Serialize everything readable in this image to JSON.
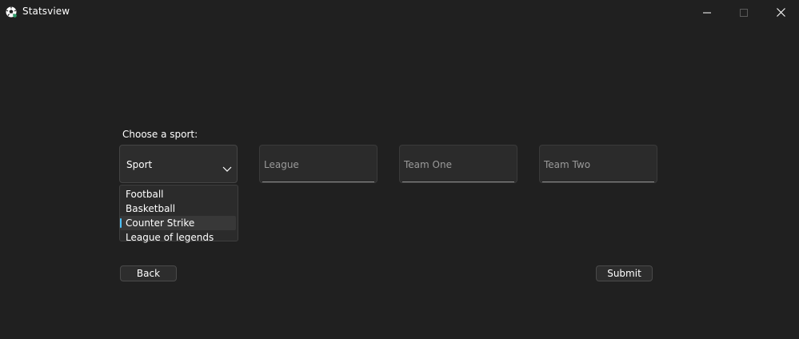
{
  "window": {
    "title": "Statsview",
    "icon": "soccer-ball-icon",
    "controls": [
      "minimize-icon",
      "maximize-icon",
      "close-icon"
    ]
  },
  "form": {
    "sport_label": "Choose a sport:",
    "sport_select": {
      "value": "Sport",
      "options": [
        "Football",
        "Basketball",
        "Counter Strike",
        "League of legends"
      ],
      "highlighted": "Counter Strike"
    },
    "league_placeholder": "League",
    "team_one_placeholder": "Team One",
    "team_two_placeholder": "Team Two"
  },
  "buttons": {
    "back": "Back",
    "submit": "Submit"
  },
  "colors": {
    "background": "#202020",
    "field": "#2b2b2b",
    "accent": "#4cc2ff"
  }
}
